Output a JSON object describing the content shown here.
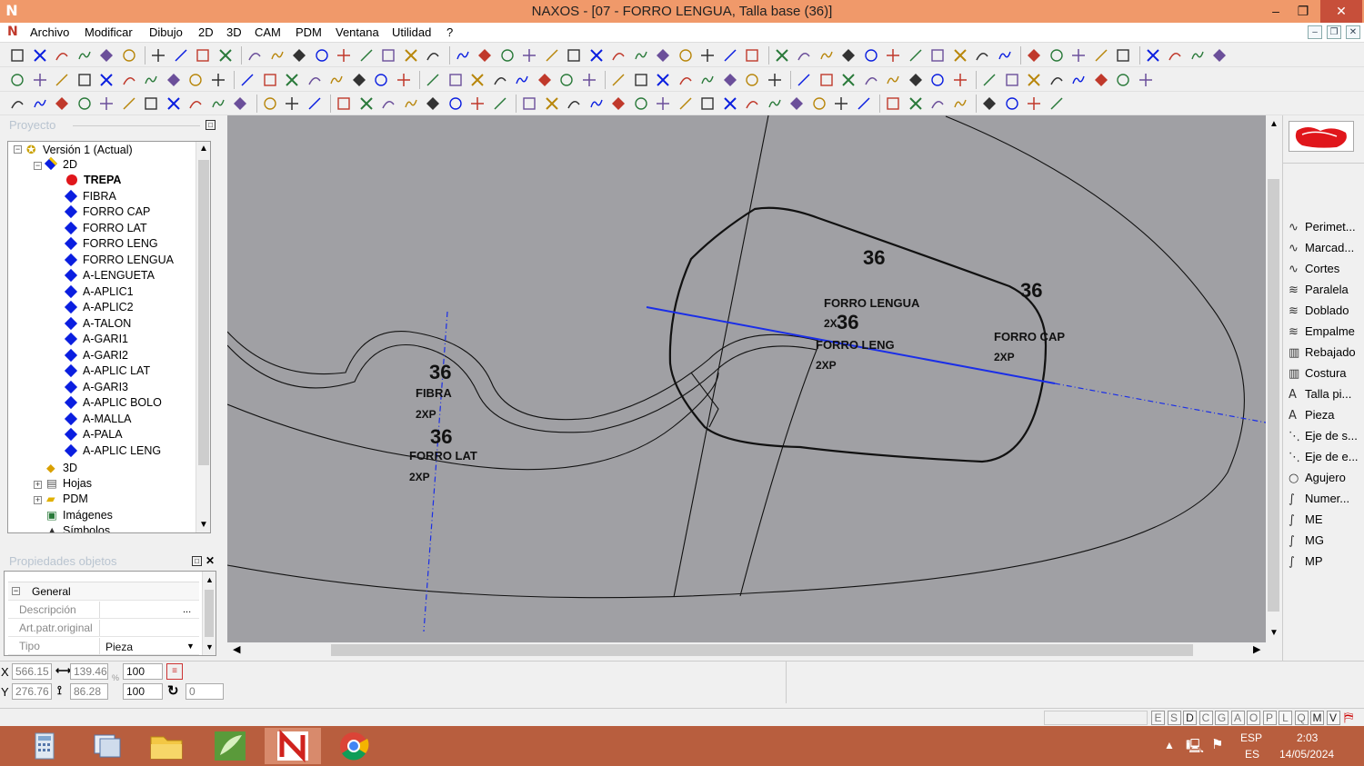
{
  "app": {
    "title": "NAXOS - [07 - FORRO LENGUA, Talla base (36)]",
    "logo_letter": "N",
    "controls": {
      "minimize": "–",
      "restore": "❐",
      "close": "✕"
    }
  },
  "menu": {
    "items": [
      "Archivo",
      "Modificar",
      "Dibujo",
      "2D",
      "3D",
      "CAM",
      "PDM",
      "Ventana",
      "Utilidad",
      "?"
    ]
  },
  "project_panel": {
    "header": "Proyecto",
    "root": "Versión 1 (Actual)",
    "group_2d": "2D",
    "layers": [
      {
        "name": "TREPA",
        "bold": true,
        "color": "#e0161b"
      },
      {
        "name": "FIBRA"
      },
      {
        "name": "FORRO CAP"
      },
      {
        "name": "FORRO LAT"
      },
      {
        "name": "FORRO LENG"
      },
      {
        "name": "FORRO LENGUA"
      },
      {
        "name": "A-LENGUETA"
      },
      {
        "name": "A-APLIC1"
      },
      {
        "name": "A-APLIC2"
      },
      {
        "name": "A-TALON"
      },
      {
        "name": "A-GARI1"
      },
      {
        "name": "A-GARI2"
      },
      {
        "name": "A-APLIC LAT"
      },
      {
        "name": "A-GARI3"
      },
      {
        "name": "A-APLIC BOLO"
      },
      {
        "name": "A-MALLA"
      },
      {
        "name": "A-PALA"
      },
      {
        "name": "A-APLIC LENG"
      }
    ],
    "others": [
      "3D",
      "Hojas",
      "PDM",
      "Imágenes",
      "Símbolos"
    ]
  },
  "properties_panel": {
    "header": "Propiedades objetos",
    "section": "General",
    "rows": [
      {
        "label": "Descripción",
        "value": "",
        "button": "..."
      },
      {
        "label": "Art.patr.original",
        "value": ""
      },
      {
        "label": "Tipo",
        "value": "Pieza"
      }
    ]
  },
  "coords": {
    "x_label": "X",
    "y_label": "Y",
    "x": "566.15",
    "y": "276.76",
    "w": "139.46",
    "h": "86.28",
    "scale_x": "100",
    "scale_y": "100",
    "angle": "0"
  },
  "canvas_labels": {
    "fibra": {
      "size": "36",
      "name": "FIBRA",
      "qty": "2XP"
    },
    "forro_lat": {
      "size": "36",
      "name": "FORRO LAT",
      "qty": "2XP"
    },
    "forro_lengua": {
      "size_top": "36",
      "name": "FORRO LENGUA",
      "size_mid": "36",
      "qty_prefix": "2X"
    },
    "forro_leng": {
      "name": "FORRO LENG",
      "qty": "2XP"
    },
    "forro_cap": {
      "size": "36",
      "name": "FORRO CAP",
      "qty": "2XP"
    }
  },
  "right_panel": {
    "items": [
      {
        "icon": "∿",
        "label": "Perimet..."
      },
      {
        "icon": "∿",
        "label": "Marcad..."
      },
      {
        "icon": "∿",
        "label": "Cortes"
      },
      {
        "icon": "≋",
        "label": "Paralela"
      },
      {
        "icon": "≋",
        "label": "Doblado"
      },
      {
        "icon": "≋",
        "label": "Empalme"
      },
      {
        "icon": "▥",
        "label": "Rebajado"
      },
      {
        "icon": "▥",
        "label": "Costura"
      },
      {
        "icon": "A",
        "label": "Talla pi..."
      },
      {
        "icon": "A",
        "label": "Pieza"
      },
      {
        "icon": "⋱",
        "label": "Eje de s..."
      },
      {
        "icon": "⋱",
        "label": "Eje de e..."
      },
      {
        "icon": "○",
        "label": "Agujero"
      },
      {
        "icon": "∫",
        "label": "Numer..."
      },
      {
        "icon": "∫",
        "label": "ME"
      },
      {
        "icon": "∫",
        "label": "MG"
      },
      {
        "icon": "∫",
        "label": "MP"
      }
    ]
  },
  "status": {
    "letters": [
      "E",
      "S",
      "D",
      "C",
      "G",
      "A",
      "O",
      "P",
      "L",
      "Q",
      "M",
      "V"
    ],
    "active_letters": [
      "D",
      "M",
      "V"
    ]
  },
  "taskbar": {
    "lang": "ESP",
    "lang_sub": "ES",
    "time": "2:03",
    "date": "14/05/2024"
  },
  "colors": {
    "titlebar": "#f0996a",
    "canvas": "#a0a0a4",
    "layer_diamond": "#0a1ee0",
    "trepa_dot": "#e0161b",
    "axis_line": "#1a2ee8",
    "taskbar": "#b85e3e"
  }
}
